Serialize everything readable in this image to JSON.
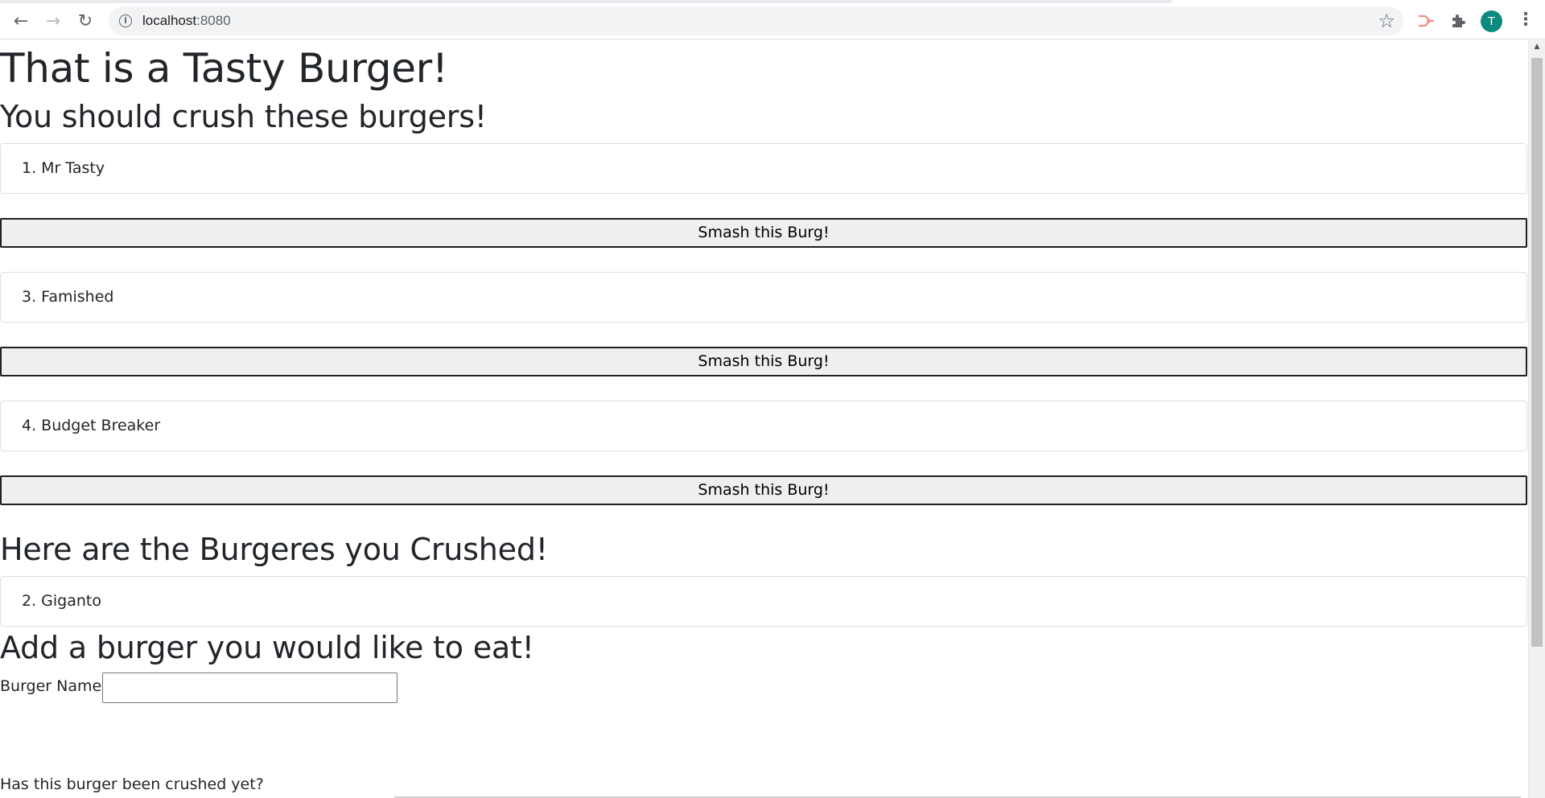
{
  "browser": {
    "url_host": "localhost",
    "url_port": ":8080",
    "avatar_initial": "T"
  },
  "page": {
    "title": "That is a Tasty Burger!",
    "uneaten_heading": "You should crush these burgers!",
    "uneaten_burgers": [
      {
        "label": "1. Mr Tasty",
        "button_label": "Smash this Burg!"
      },
      {
        "label": "3. Famished",
        "button_label": "Smash this Burg!"
      },
      {
        "label": "4. Budget Breaker",
        "button_label": "Smash this Burg!"
      }
    ],
    "eaten_heading": "Here are the Burgeres you Crushed!",
    "eaten_burgers": [
      {
        "label": "2. Giganto"
      }
    ],
    "form": {
      "heading": "Add a burger you would like to eat!",
      "name_label": "Burger Name:",
      "name_value": "",
      "crushed_question": "Has this burger been crushed yet?"
    }
  }
}
